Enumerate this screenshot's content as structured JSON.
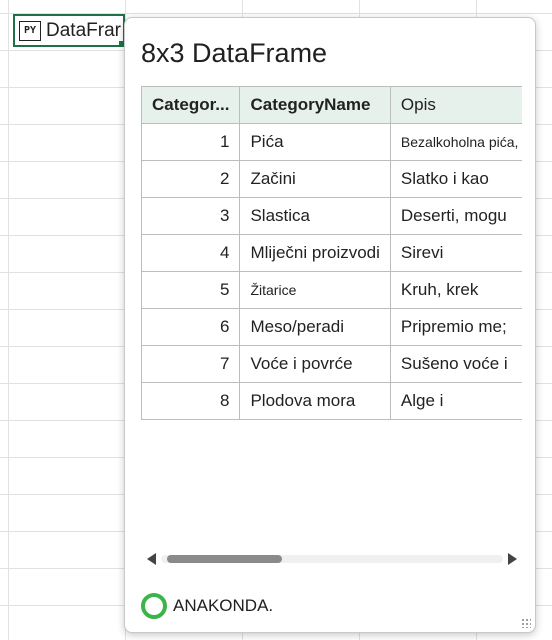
{
  "cell": {
    "badge": "PY",
    "text": "DataFrar"
  },
  "card": {
    "title": "8x3 DataFrame",
    "table": {
      "columns": [
        "Categor...",
        "CategoryName",
        "Opis"
      ],
      "rows": [
        [
          "1",
          "Pića",
          "Bezalkoholna pića, c"
        ],
        [
          "2",
          "Začini",
          "Slatko i kao"
        ],
        [
          "3",
          "Slastica",
          "Deserti, mogu"
        ],
        [
          "4",
          "Mliječni proizvodi",
          "Sirevi"
        ],
        [
          "5",
          "Žitarice",
          "Kruh, krek"
        ],
        [
          "6",
          "Meso/peradi",
          "Pripremio me;"
        ],
        [
          "7",
          "Voće i povrće",
          "Sušeno voće i"
        ],
        [
          "8",
          "Plodova mora",
          "Alge i"
        ]
      ]
    },
    "footer": {
      "text": "ANAKONDA."
    }
  },
  "colors": {
    "cell_border": "#1e7145",
    "header_bg": "#e7f1eb",
    "spinner": "#3bb54a"
  }
}
